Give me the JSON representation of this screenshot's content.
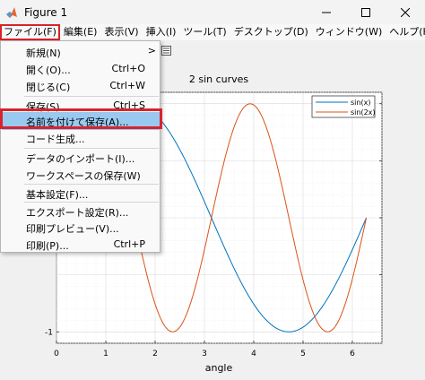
{
  "window": {
    "title": "Figure 1"
  },
  "menubar": {
    "items": [
      {
        "label": "ファイル(F)"
      },
      {
        "label": "編集(E)"
      },
      {
        "label": "表示(V)"
      },
      {
        "label": "挿入(I)"
      },
      {
        "label": "ツール(T)"
      },
      {
        "label": "デスクトップ(D)"
      },
      {
        "label": "ウィンドウ(W)"
      },
      {
        "label": "ヘルプ(H)"
      }
    ]
  },
  "file_menu": {
    "items": [
      {
        "label": "新規(N)",
        "shortcut": "",
        "submenu": true
      },
      {
        "label": "開く(O)...",
        "shortcut": "Ctrl+O"
      },
      {
        "label": "閉じる(C)",
        "shortcut": "Ctrl+W"
      },
      {
        "label": "保存(S)",
        "shortcut": "Ctrl+S"
      },
      {
        "label": "名前を付けて保存(A)...",
        "shortcut": "",
        "highlighted": true
      },
      {
        "label": "コード生成...",
        "shortcut": ""
      },
      {
        "label": "データのインポート(I)...",
        "shortcut": ""
      },
      {
        "label": "ワークスペースの保存(W)",
        "shortcut": ""
      },
      {
        "label": "基本設定(F)...",
        "shortcut": ""
      },
      {
        "label": "エクスポート設定(R)...",
        "shortcut": ""
      },
      {
        "label": "印刷プレビュー(V)...",
        "shortcut": ""
      },
      {
        "label": "印刷(P)...",
        "shortcut": "Ctrl+P"
      }
    ],
    "submenu_arrow": ">"
  },
  "colors": {
    "sin": "#0072bd",
    "sin2": "#d95319",
    "highlight": "#99c9ef",
    "annotation": "#d9232b"
  },
  "chart_data": {
    "type": "line",
    "title": "2 sin curves",
    "xlabel": "angle",
    "ylabel": "",
    "xlim": [
      0,
      6.6
    ],
    "ylim": [
      -1.1,
      1.1
    ],
    "xticks": [
      0,
      1,
      2,
      3,
      4,
      5,
      6
    ],
    "yticks_visible": [
      -1
    ],
    "grid": "minor",
    "legend_position": "top-right",
    "series": [
      {
        "name": "sin(x)",
        "function": "sin(x)",
        "x_range": [
          0,
          6.2832
        ]
      },
      {
        "name": "sin(2x)",
        "function": "sin(2x)",
        "x_range": [
          0,
          6.2832
        ]
      }
    ]
  }
}
